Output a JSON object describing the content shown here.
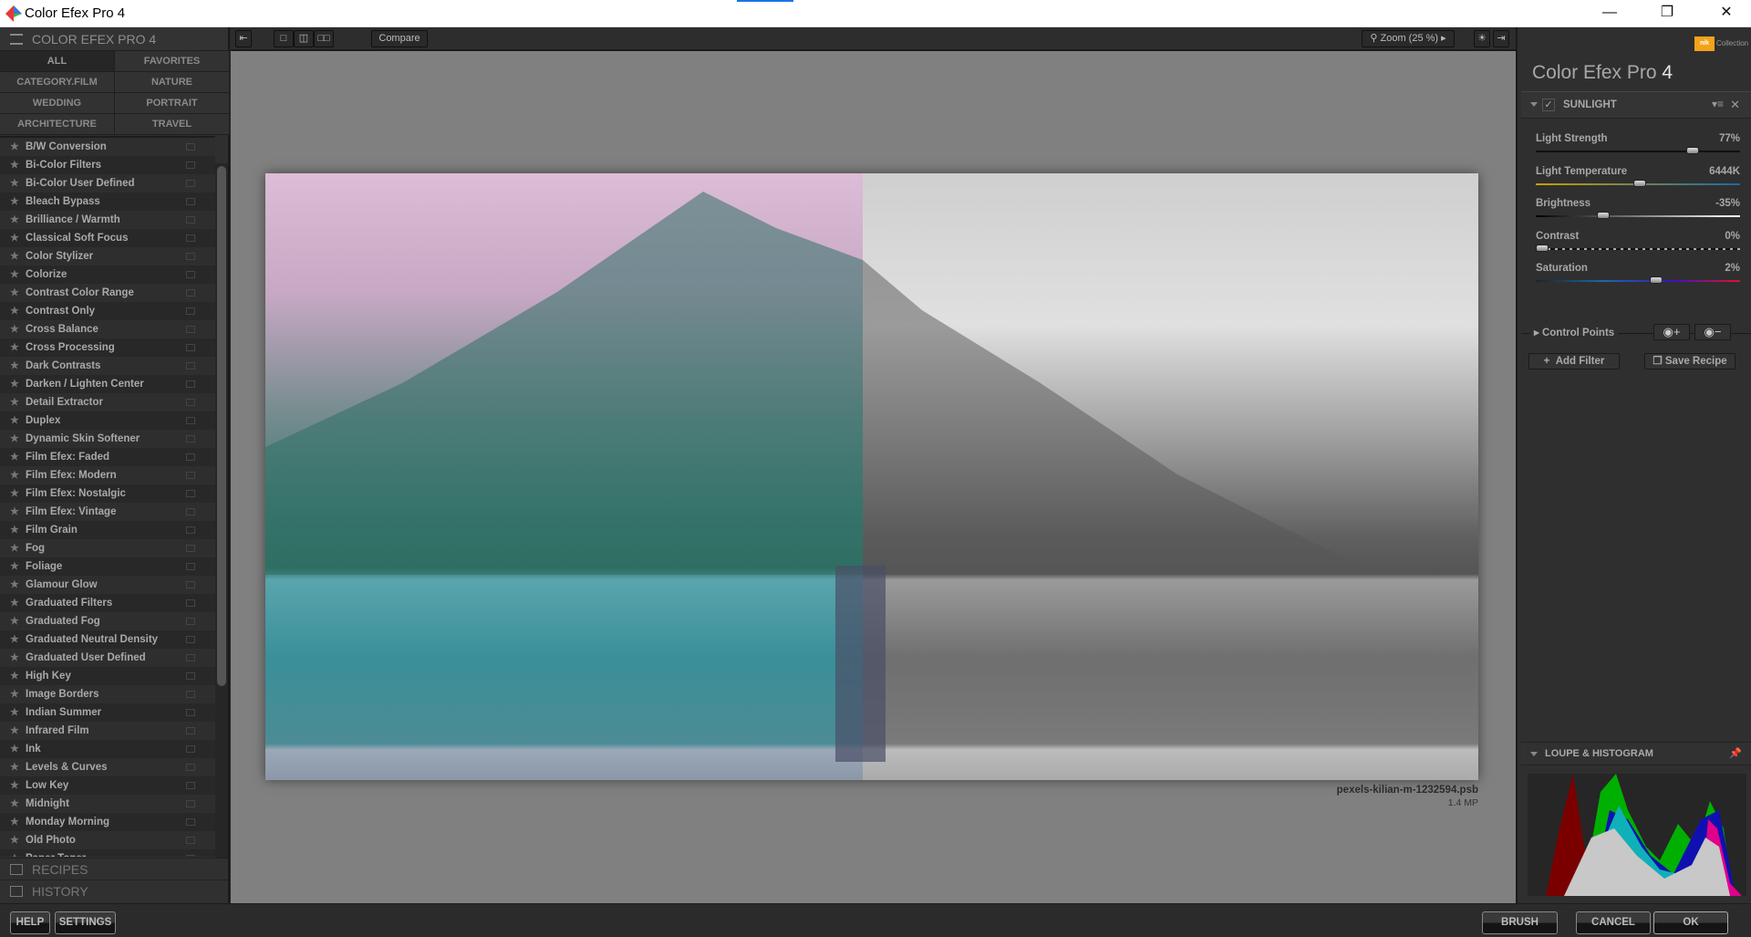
{
  "window": {
    "title": "Color Efex Pro 4",
    "controls": [
      "minimize",
      "maximize",
      "close"
    ]
  },
  "left_panel": {
    "header": "COLOR EFEX PRO 4",
    "categories": [
      "ALL",
      "FAVORITES",
      "CATEGORY.FILM",
      "NATURE",
      "WEDDING",
      "PORTRAIT",
      "ARCHITECTURE",
      "TRAVEL"
    ],
    "selected_category": "ALL",
    "filters": [
      "B/W Conversion",
      "Bi-Color Filters",
      "Bi-Color User Defined",
      "Bleach Bypass",
      "Brilliance / Warmth",
      "Classical Soft Focus",
      "Color Stylizer",
      "Colorize",
      "Contrast Color Range",
      "Contrast Only",
      "Cross Balance",
      "Cross Processing",
      "Dark Contrasts",
      "Darken / Lighten Center",
      "Detail Extractor",
      "Duplex",
      "Dynamic Skin Softener",
      "Film Efex: Faded",
      "Film Efex: Modern",
      "Film Efex: Nostalgic",
      "Film Efex: Vintage",
      "Film Grain",
      "Fog",
      "Foliage",
      "Glamour Glow",
      "Graduated Filters",
      "Graduated Fog",
      "Graduated Neutral Density",
      "Graduated User Defined",
      "High Key",
      "Image Borders",
      "Indian Summer",
      "Infrared Film",
      "Ink",
      "Levels & Curves",
      "Low Key",
      "Midnight",
      "Monday Morning",
      "Old Photo",
      "Paper Toner"
    ],
    "recipes": "RECIPES",
    "history": "HISTORY"
  },
  "toolbar": {
    "compare": "Compare",
    "zoom": "Zoom (25 %)"
  },
  "canvas": {
    "filename": "pexels-kilian-m-1232594.psb",
    "megapixels": "1.4 MP"
  },
  "right_panel": {
    "brand": "Collection",
    "brand_logo": "nik",
    "title": "Color Efex Pro",
    "title_version": "4",
    "filter": {
      "name": "SUNLIGHT",
      "enabled": true,
      "sliders": [
        {
          "label": "Light Strength",
          "value": "77%",
          "position": 0.77
        },
        {
          "label": "Light Temperature",
          "value": "6444K",
          "position": 0.51
        },
        {
          "label": "Brightness",
          "value": "-35%",
          "position": 0.33
        },
        {
          "label": "Contrast",
          "value": "0%",
          "position": 0.03
        },
        {
          "label": "Saturation",
          "value": "2%",
          "position": 0.59
        }
      ]
    },
    "control_points": "Control Points",
    "add_filter": "Add Filter",
    "save_recipe": "Save Recipe",
    "loupe": "LOUPE & HISTOGRAM"
  },
  "footer": {
    "help": "HELP",
    "settings": "SETTINGS",
    "brush": "BRUSH",
    "cancel": "CANCEL",
    "ok": "OK"
  }
}
